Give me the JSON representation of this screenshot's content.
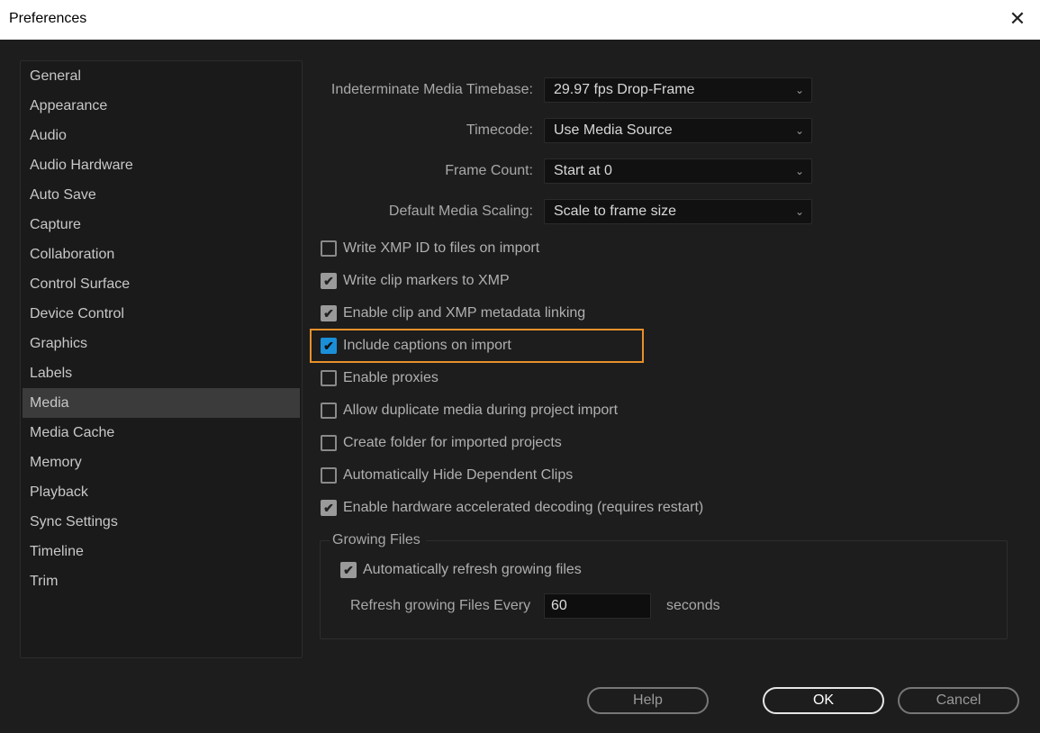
{
  "window": {
    "title": "Preferences",
    "close_icon": "close-icon"
  },
  "sidebar": {
    "items": [
      {
        "label": "General"
      },
      {
        "label": "Appearance"
      },
      {
        "label": "Audio"
      },
      {
        "label": "Audio Hardware"
      },
      {
        "label": "Auto Save"
      },
      {
        "label": "Capture"
      },
      {
        "label": "Collaboration"
      },
      {
        "label": "Control Surface"
      },
      {
        "label": "Device Control"
      },
      {
        "label": "Graphics"
      },
      {
        "label": "Labels"
      },
      {
        "label": "Media",
        "selected": true
      },
      {
        "label": "Media Cache"
      },
      {
        "label": "Memory"
      },
      {
        "label": "Playback"
      },
      {
        "label": "Sync Settings"
      },
      {
        "label": "Timeline"
      },
      {
        "label": "Trim"
      }
    ]
  },
  "fields": [
    {
      "label": "Indeterminate Media Timebase:",
      "value": "29.97 fps Drop-Frame"
    },
    {
      "label": "Timecode:",
      "value": "Use Media Source"
    },
    {
      "label": "Frame Count:",
      "value": "Start at 0"
    },
    {
      "label": "Default Media Scaling:",
      "value": "Scale to frame size"
    }
  ],
  "checkboxes": [
    {
      "label": "Write XMP ID to files on import",
      "checked": false
    },
    {
      "label": "Write clip markers to XMP",
      "checked": true
    },
    {
      "label": "Enable clip and XMP metadata linking",
      "checked": true
    },
    {
      "label": "Include captions on import",
      "checked": true,
      "focused": true
    },
    {
      "label": "Enable proxies",
      "checked": false
    },
    {
      "label": "Allow duplicate media during project import",
      "checked": false
    },
    {
      "label": "Create folder for imported projects",
      "checked": false
    },
    {
      "label": "Automatically Hide Dependent Clips",
      "checked": false
    },
    {
      "label": "Enable hardware accelerated decoding (requires restart)",
      "checked": true
    }
  ],
  "growing": {
    "title": "Growing Files",
    "auto_refresh_label": "Automatically refresh growing files",
    "auto_refresh_checked": true,
    "refresh_label": "Refresh growing Files Every",
    "refresh_value": "60",
    "unit": "seconds"
  },
  "buttons": {
    "help": "Help",
    "ok": "OK",
    "cancel": "Cancel"
  },
  "colors": {
    "accent": "#1a8fd8",
    "focus": "#e8902a"
  }
}
